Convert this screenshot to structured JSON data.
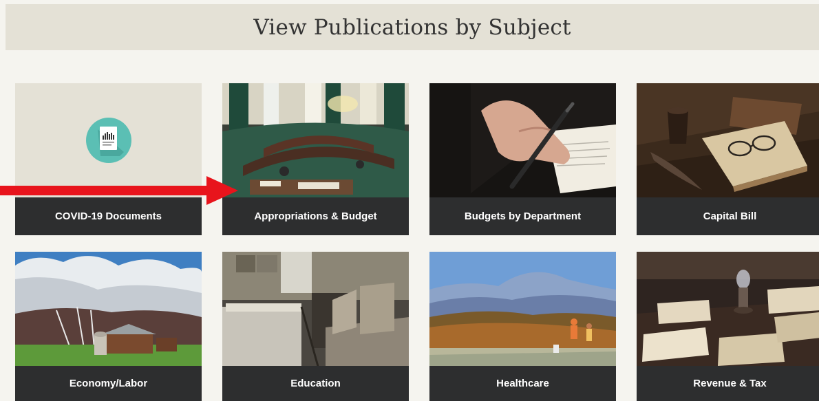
{
  "header": {
    "title": "View Publications by Subject"
  },
  "cards": [
    {
      "label": "COVID-19 Documents",
      "image": "document-icon"
    },
    {
      "label": "Appropriations & Budget",
      "image": "legislative-chamber-photo"
    },
    {
      "label": "Budgets by Department",
      "image": "hand-with-pen-photo"
    },
    {
      "label": "Capital Bill",
      "image": "old-book-and-spectacles-photo"
    },
    {
      "label": "Economy/Labor",
      "image": "farm-landscape-photo"
    },
    {
      "label": "Education",
      "image": "old-schoolroom-photo"
    },
    {
      "label": "Healthcare",
      "image": "mountain-hikers-photo"
    },
    {
      "label": "Revenue & Tax",
      "image": "old-ledgers-photo"
    }
  ],
  "annotation": {
    "arrow_color": "#e8141c",
    "pointing_to": "Appropriations & Budget"
  },
  "colors": {
    "header_bg": "#e4e1d6",
    "page_bg": "#f5f4ef",
    "label_bg": "#2d2e2f",
    "icon_circle": "#5bbfb4"
  }
}
